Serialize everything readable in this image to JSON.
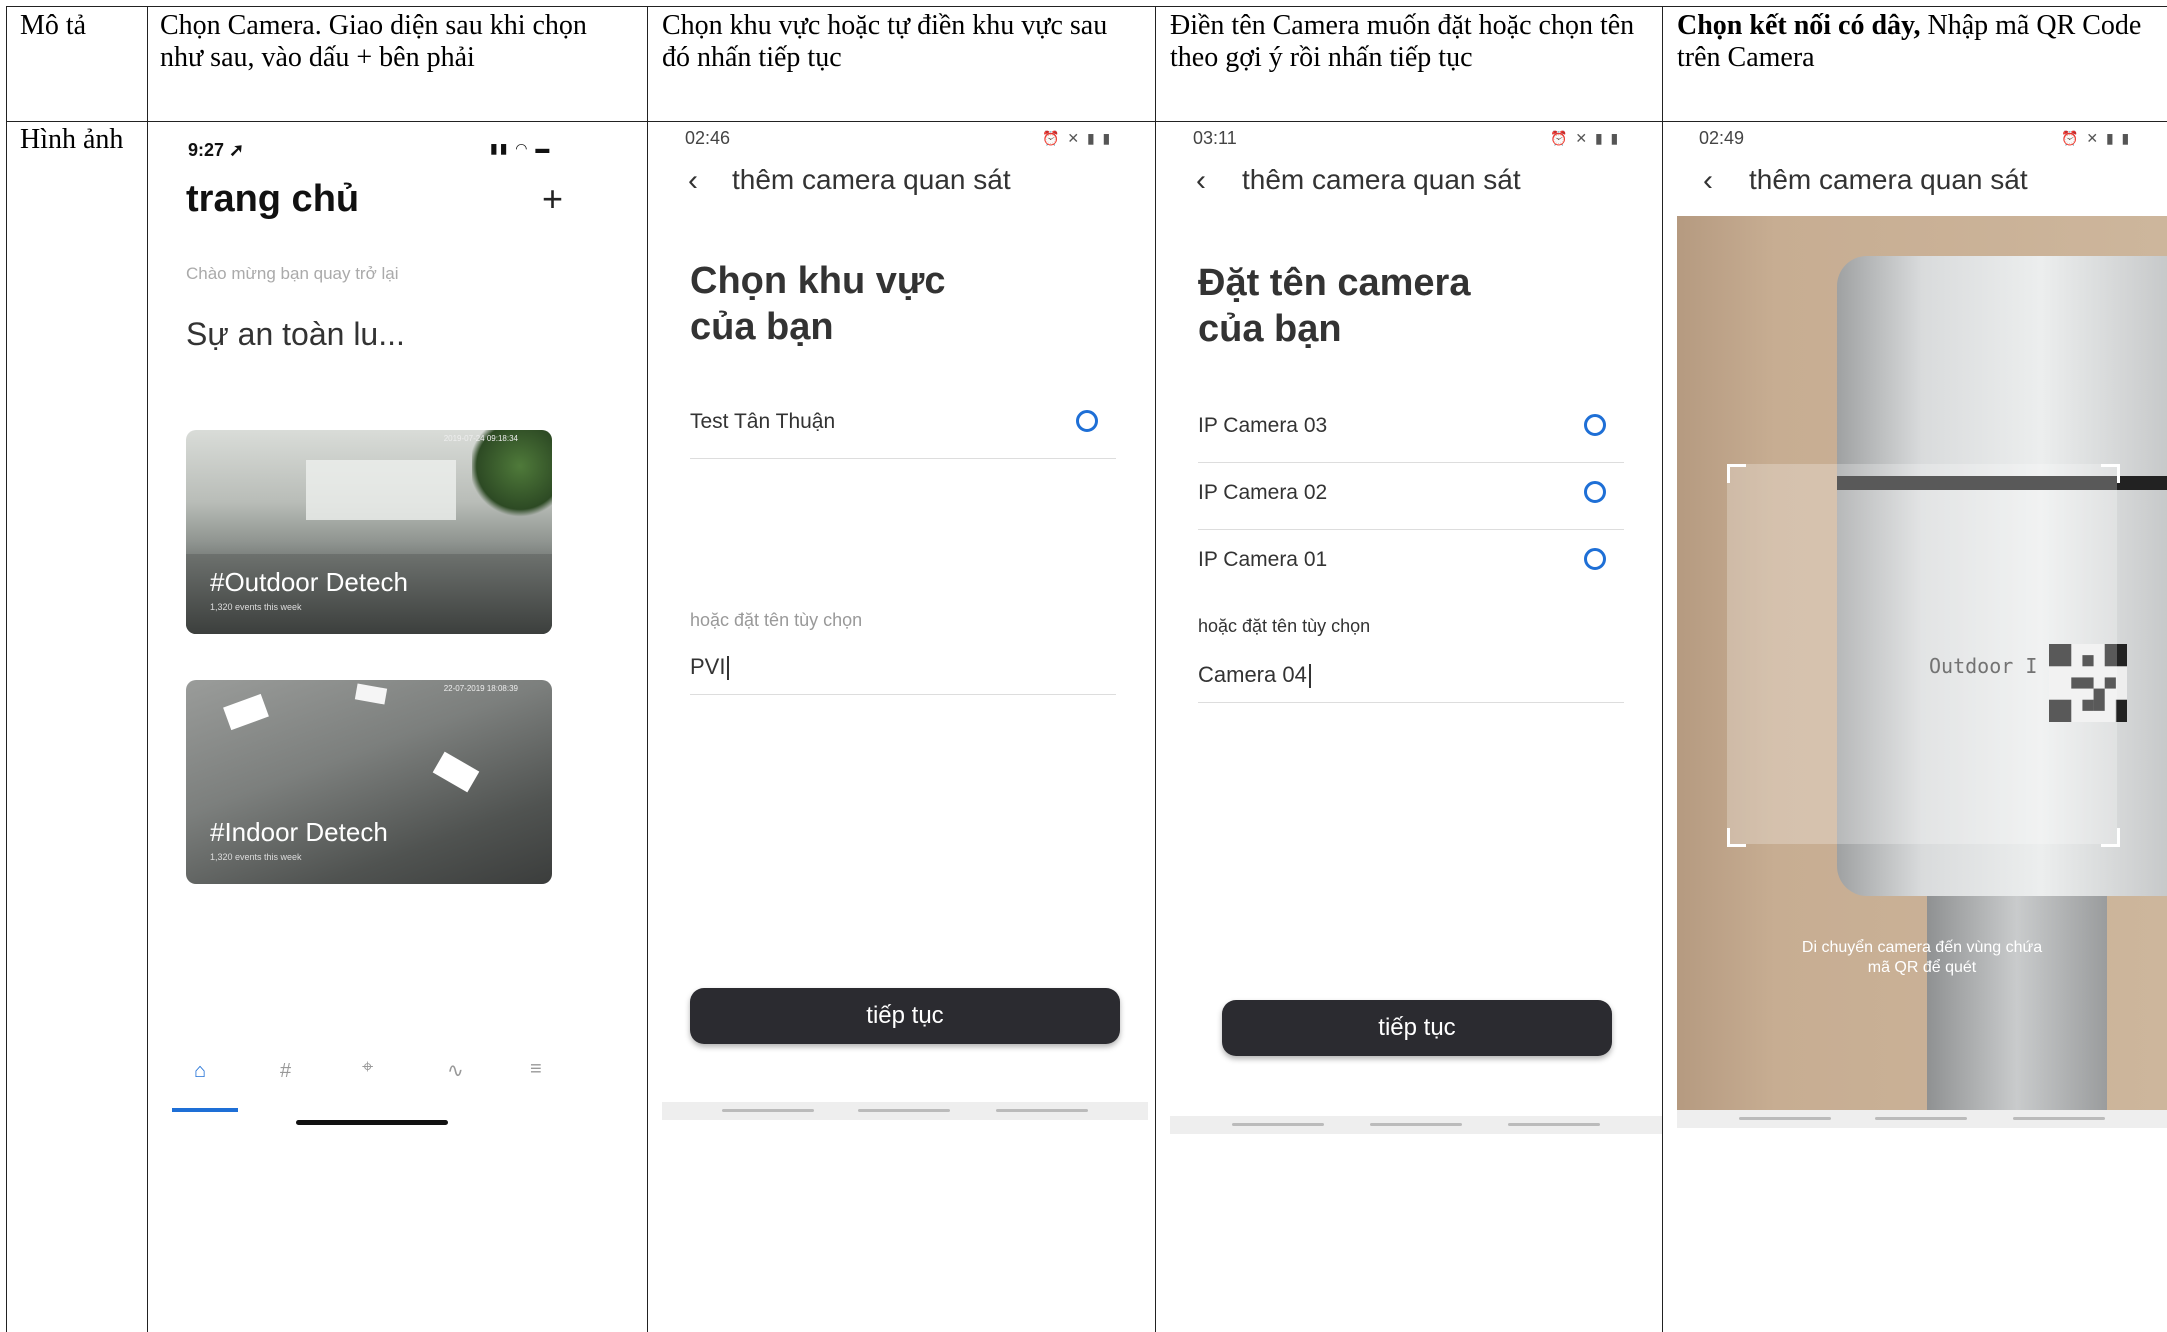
{
  "table": {
    "row1_label": "Mô tả",
    "row2_label": "Hình ảnh",
    "col1_desc": "Chọn Camera. Giao diện sau khi chọn như sau, vào dấu + bên phải",
    "col2_desc": "Chọn khu vực  hoặc tự điền khu vực sau đó nhấn tiếp tục",
    "col3_desc": "Điền tên Camera muốn đặt hoặc chọn tên theo gợi ý rồi nhấn tiếp tục",
    "col4_desc_bold": "Chọn kết nối có dây,",
    "col4_desc_rest": " Nhập mã QR Code trên Camera"
  },
  "home": {
    "time": "9:27",
    "title": "trang chủ",
    "plus": "+",
    "welcome": "Chào mừng bạn quay trở lại",
    "tagline": "Sự an toàn lu...",
    "cards": [
      {
        "name": "#Outdoor Detech",
        "events": "1,320 events this week",
        "ts": "2019-07-24 09:18:34"
      },
      {
        "name": "#Indoor Detech",
        "events": "1,320 events this week",
        "ts": "22-07-2019 18:08:39"
      }
    ],
    "tabs": [
      {
        "icon": "home-icon",
        "glyph": "⌂"
      },
      {
        "icon": "hash-icon",
        "glyph": "#"
      },
      {
        "icon": "target-icon",
        "glyph": "⌖"
      },
      {
        "icon": "activity-icon",
        "glyph": "∿"
      },
      {
        "icon": "menu-icon",
        "glyph": "≡"
      }
    ]
  },
  "area": {
    "time": "02:46",
    "nav_title": "thêm camera quan sát",
    "heading_line1": "Chọn khu vực",
    "heading_line2": "của bạn",
    "options": [
      "Test Tân Thuận"
    ],
    "hint": "hoặc đặt tên tùy chọn",
    "input_value": "PVI",
    "button": "tiếp tục"
  },
  "name": {
    "time": "03:11",
    "nav_title": "thêm camera quan sát",
    "heading_line1": "Đặt tên camera",
    "heading_line2": "của bạn",
    "options": [
      "IP Camera 03",
      "IP Camera 02",
      "IP Camera 01"
    ],
    "hint": "hoặc đặt tên tùy chọn",
    "input_value": "Camera 04",
    "button": "tiếp tục"
  },
  "qr": {
    "time": "02:49",
    "nav_title": "thêm camera quan sát",
    "label_text": "Outdoor I",
    "message": "Di chuyển camera đến vùng chứa mã QR để quét"
  },
  "colors": {
    "accent": "#1e6fd6",
    "button_bg": "#2b2b30"
  }
}
